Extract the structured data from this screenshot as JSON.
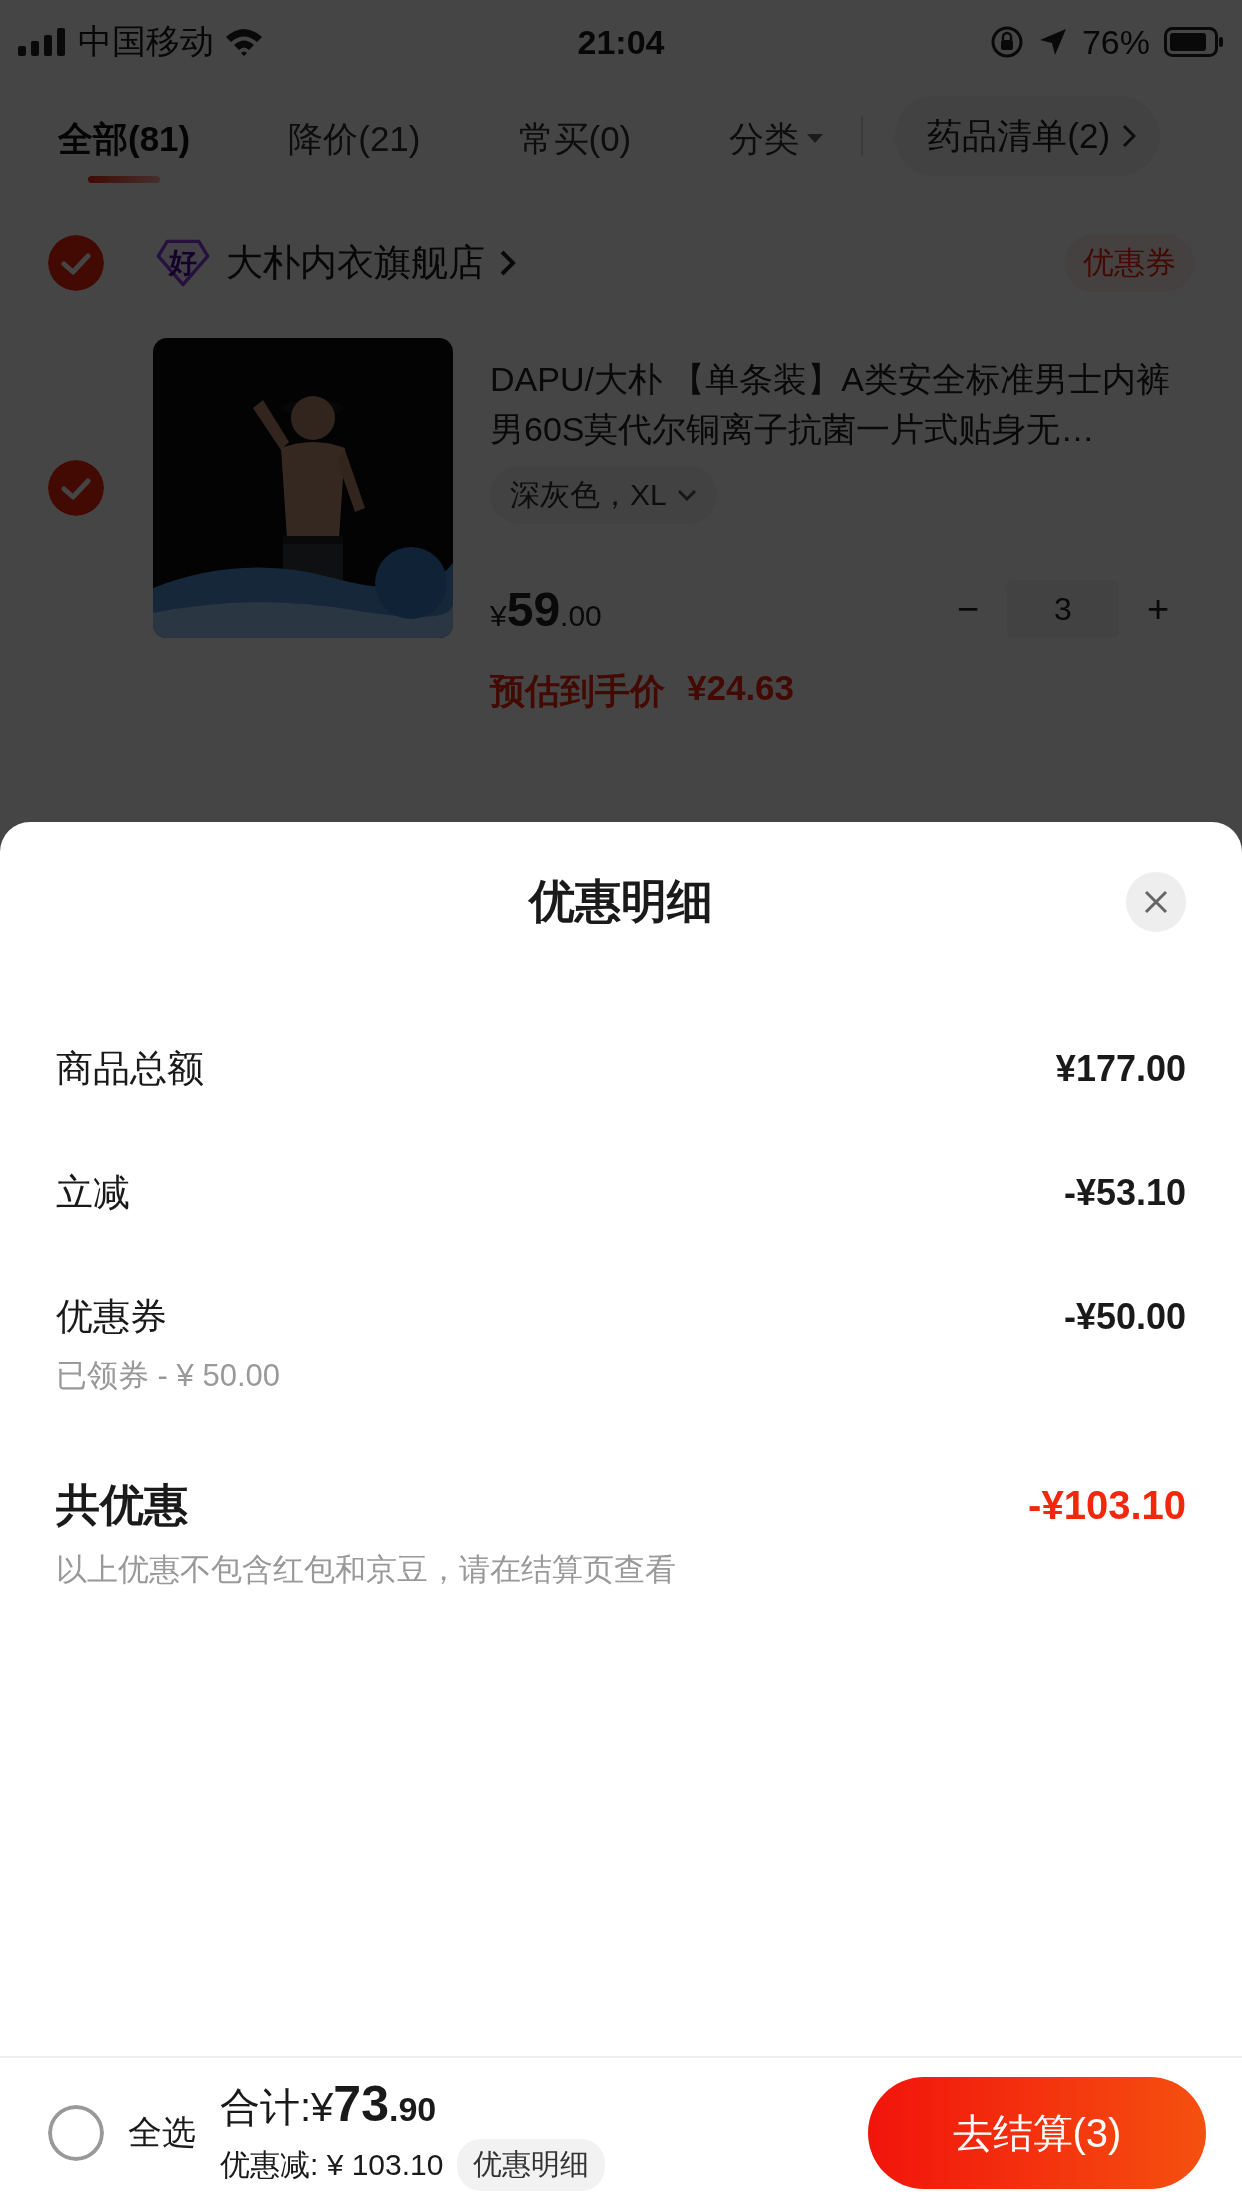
{
  "status_bar": {
    "carrier": "中国移动",
    "time": "21:04",
    "battery": "76%"
  },
  "tabs": [
    {
      "label": "全部(81)",
      "selected": true,
      "kind": "plain"
    },
    {
      "label": "降价(21)",
      "selected": false,
      "kind": "plain"
    },
    {
      "label": "常买(0)",
      "selected": false,
      "kind": "plain"
    },
    {
      "label": "分类",
      "selected": false,
      "kind": "dropdown"
    }
  ],
  "list_button": {
    "label": "药品清单(2)"
  },
  "store": {
    "checked": true,
    "badge": "好",
    "name": "大朴内衣旗舰店",
    "coupon": "优惠券"
  },
  "product": {
    "checked": true,
    "title": "DAPU/大朴 【单条装】A类安全标准男士内裤男60S莫代尔铜离子抗菌一片式贴身无…",
    "spec": "深灰色，XL",
    "price_symbol": "¥",
    "price_integer": "59",
    "price_decimal": ".00",
    "minus": "−",
    "quantity": "3",
    "plus": "+",
    "estimate_label": "预估到手价",
    "estimate_price": "¥24.63"
  },
  "sheet": {
    "title": "优惠明细",
    "rows": [
      {
        "label": "商品总额",
        "value": "¥177.00"
      },
      {
        "label": "立减",
        "value": "-¥53.10"
      },
      {
        "label": "优惠券",
        "value": "-¥50.00",
        "note": "已领券 - ¥ 50.00"
      }
    ],
    "total": {
      "label": "共优惠",
      "value": "-¥103.10",
      "note": "以上优惠不包含红包和京豆，请在结算页查看"
    }
  },
  "bottom_bar": {
    "select_all": {
      "label": "全选",
      "checked": false
    },
    "total_label": "合计:¥",
    "total_integer": "73",
    "total_decimal": ".90",
    "discount": "优惠减: ¥ 103.10",
    "details_button": "优惠明细",
    "checkout_button": "去结算(3)"
  }
}
